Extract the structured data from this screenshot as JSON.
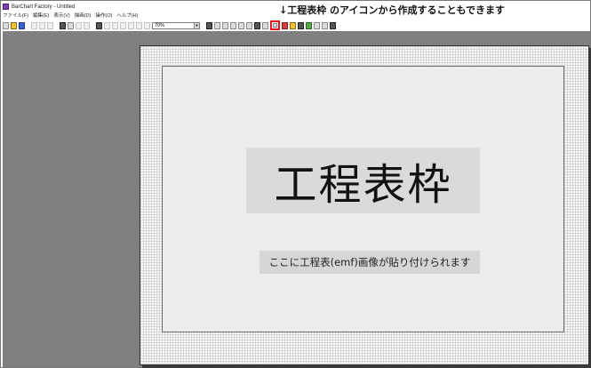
{
  "window": {
    "title": "BarChart Factory - Untitled",
    "icon": "barchart-app-icon"
  },
  "annotation": {
    "text": "↓工程表枠 のアイコンから作成することもできます",
    "highlight_color": "#e8151e"
  },
  "menu": {
    "items": [
      {
        "label": "ファイル(F)"
      },
      {
        "label": "編集(E)"
      },
      {
        "label": "表示(V)"
      },
      {
        "label": "描画(D)"
      },
      {
        "label": "操作(O)"
      },
      {
        "label": "ヘルプ(H)"
      }
    ]
  },
  "toolbar": {
    "zoom_value": "70%",
    "zoom_arrow": "▼"
  },
  "canvas": {
    "workspace_color": "#808080",
    "frame_label": "工程表枠",
    "paste_note": "ここに工程表(emf)画像が貼り付けられます"
  }
}
